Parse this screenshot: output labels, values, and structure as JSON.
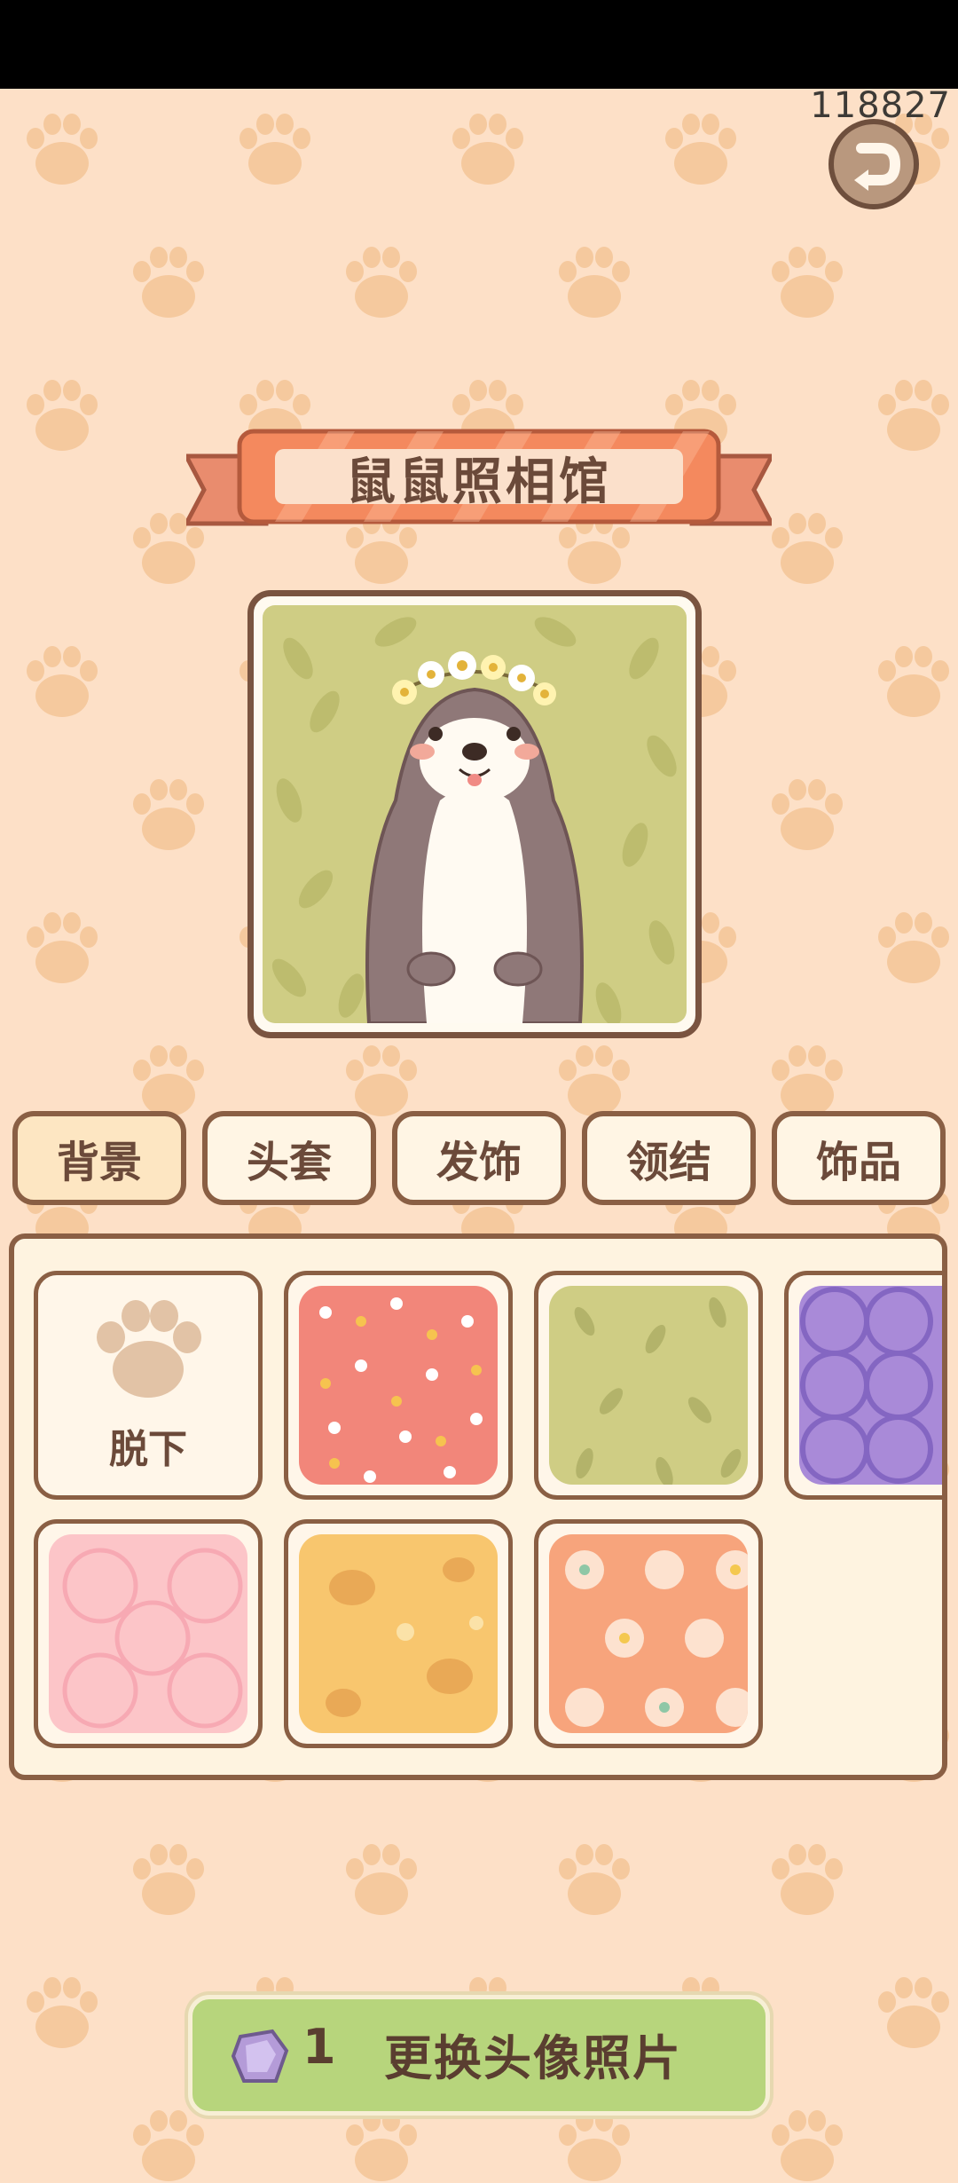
{
  "status": {
    "score": "118827"
  },
  "header": {
    "title": "鼠鼠照相馆"
  },
  "tabs": [
    {
      "label": "背景",
      "active": true
    },
    {
      "label": "头套",
      "active": false
    },
    {
      "label": "发饰",
      "active": false
    },
    {
      "label": "领结",
      "active": false
    },
    {
      "label": "饰品",
      "active": false
    }
  ],
  "items": {
    "remove_label": "脱下",
    "backgrounds": [
      "coral-hearts",
      "olive-leaves",
      "purple-floral",
      "pink-lattice",
      "yellow-paws",
      "orange-flowers"
    ]
  },
  "action": {
    "cost": "1",
    "label": "更换头像照片",
    "icon": "crystal-gem-icon"
  },
  "colors": {
    "background": "#fde0c7",
    "accent": "#f2865a",
    "button": "#b7d57c",
    "border": "#8a5f44"
  }
}
